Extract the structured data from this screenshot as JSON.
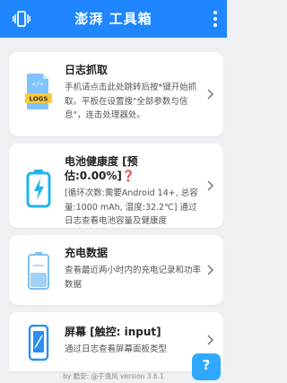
{
  "app": {
    "title": "澎湃 工具箱",
    "top_left_icon": "vibrate-phone-icon",
    "top_right_icon": "more-vert-icon",
    "accent_color": "#1f86ff"
  },
  "cards": [
    {
      "title": "日志抓取",
      "description": "手机请点击此处跳转后按*键开始抓取。平板在设置搜\"全部参数与信息\"，连击处理器处。",
      "icon": "logs-file-icon",
      "icon_label": "LOGS"
    },
    {
      "title": "电池健康度 [预估:0.00%]",
      "title_badge": "❓",
      "description": "[循环次数:需要Android 14+, 总容量:1000 mAh, 温度:32.2℃] 通过日志查看电池容量及健康度",
      "icon": "battery-charging-icon"
    },
    {
      "title": "充电数据",
      "description": "查看最近两小时内的充电记录和功率数据",
      "icon": "battery-level-icon"
    },
    {
      "title": "屏幕 [触控: input]",
      "description": "通过日志查看屏幕面板类型",
      "icon": "phone-screen-icon"
    }
  ],
  "footer": "by 酷安: @于逸风 version 3.6.1",
  "help_button": {
    "label": "?",
    "icon": "help-chat-icon"
  }
}
